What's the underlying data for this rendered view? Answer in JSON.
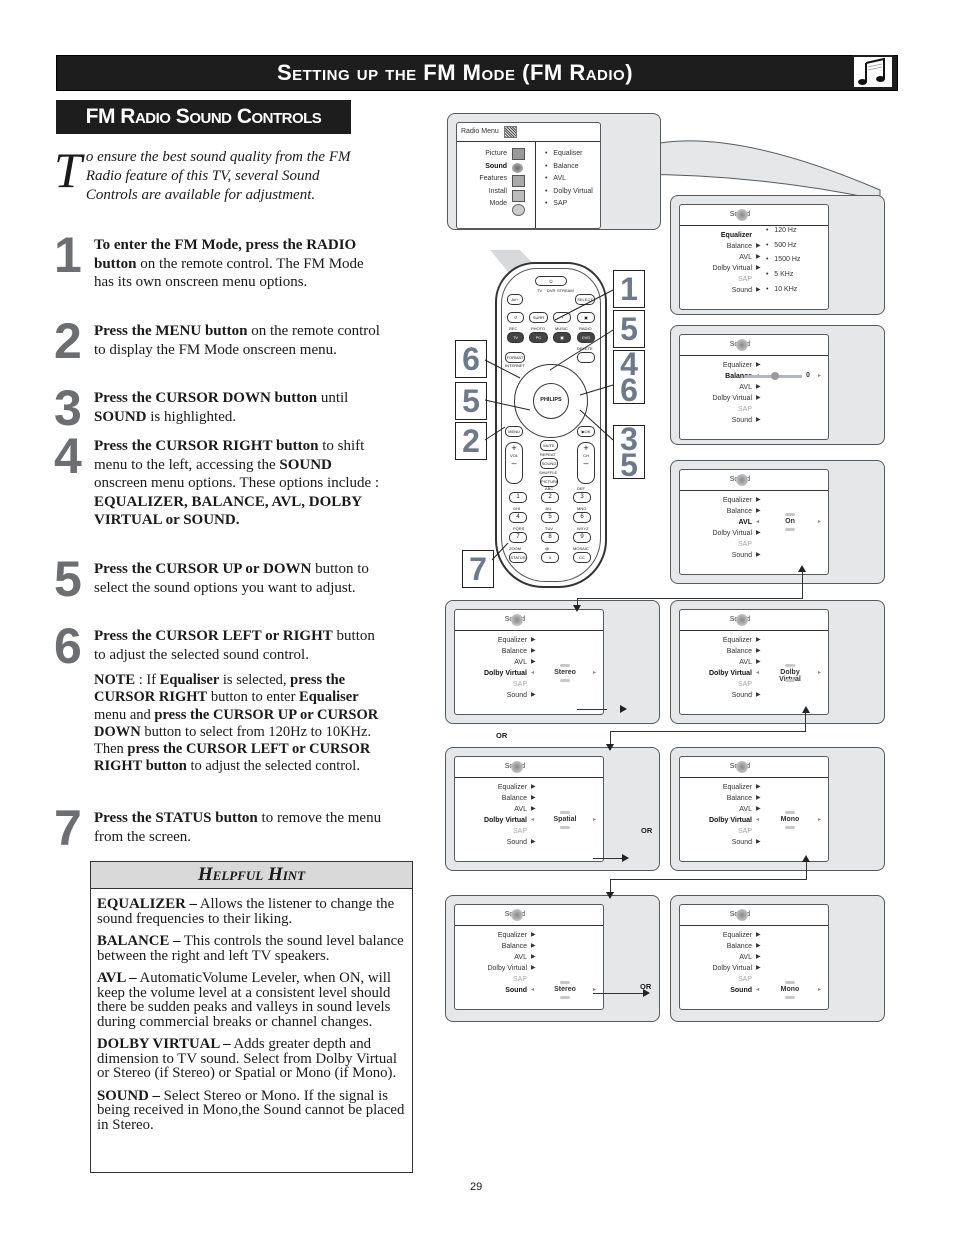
{
  "header": {
    "title": "Setting up the FM Mode (FM Radio)",
    "icon": "music-note-icon"
  },
  "section": {
    "title": "FM Radio Sound Controls"
  },
  "intro": {
    "dropcap": "T",
    "text": "o ensure the best sound quality from the FM Radio feature of this TV, several Sound Controls are available for adjustment."
  },
  "steps": [
    {
      "num": "1",
      "bold": "To enter the FM Mode, press the RADIO button",
      "text": " on the remote control. The FM Mode has its own onscreen menu options."
    },
    {
      "num": "2",
      "bold": "Press the MENU button",
      "text": " on the remote control to display the FM Mode onscreen menu."
    },
    {
      "num": "3",
      "bold": "Press the CURSOR DOWN button",
      "text": " until ",
      "bold2": "SOUND",
      "text2": " is highlighted."
    },
    {
      "num": "4",
      "bold": "Press the CURSOR RIGHT button",
      "text": " to shift menu to the left, accessing the ",
      "bold2": "SOUND",
      "text2": " onscreen menu options. These options include : ",
      "bold3": "EQUALIZER, BALANCE, AVL, DOLBY VIRTUAL or SOUND."
    },
    {
      "num": "5",
      "bold": "Press the CURSOR UP or DOWN",
      "text": " button to select the sound options you want to adjust."
    },
    {
      "num": "6",
      "bold": "Press the CURSOR LEFT or RIGHT",
      "text": " button to adjust the selected sound control."
    },
    {
      "num": "7",
      "bold": "Press the STATUS button",
      "text": " to remove the menu from the screen."
    }
  ],
  "note": {
    "p1": "NOTE",
    "p2": " : If ",
    "p3": "Equaliser",
    "p4": " is selected, ",
    "p5": "press the CURSOR RIGHT",
    "p6": " button to enter ",
    "p7": "Equaliser",
    "p8": " menu and ",
    "p9": "press the CURSOR UP or CURSOR DOWN",
    "p10": "  button to select from 120Hz to 10KHz. Then ",
    "p11": "press the CURSOR LEFT or CURSOR RIGHT button",
    "p12": " to adjust the selected control."
  },
  "hint": {
    "title": "Helpful Hint",
    "items": [
      {
        "term": "EQUALIZER  –",
        "desc": "  Allows the listener to change the sound frequencies to their liking."
      },
      {
        "term": "BALANCE  –",
        "desc": "  This controls the sound level balance between the right and left TV speakers."
      },
      {
        "term": "AVL –",
        "desc": "  AutomaticVolume Leveler, when ON, will keep the volume level at a consistent level should there be sudden peaks and valleys in sound levels during commercial breaks or channel changes."
      },
      {
        "term": "DOLBY VIRTUAL –",
        "desc": "  Adds greater depth and dimension to TV sound. Select from Dolby Virtual or Stereo (if Stereo) or Spatial or Mono (if Mono)."
      },
      {
        "term": "SOUND  –",
        "desc": "  Select Stereo or Mono. If the signal is being received in Mono,the Sound cannot be placed in Stereo."
      }
    ]
  },
  "radio_menu": {
    "title": "Radio Menu",
    "left": [
      {
        "label": "Picture",
        "icon": "picture-icon"
      },
      {
        "label": "Sound",
        "icon": "sound-icon",
        "selected": true
      },
      {
        "label": "Features",
        "icon": "features-icon"
      },
      {
        "label": "Install",
        "icon": "install-icon"
      },
      {
        "label": "Mode",
        "icon": "mode-icon"
      }
    ],
    "right": [
      "Equaliser",
      "Balance",
      "AVL",
      "Dolby Virtual",
      "SAP"
    ]
  },
  "sound_menu": {
    "title": "Sound",
    "items": [
      "Equalizer",
      "Balance",
      "AVL",
      "Dolby Virtual",
      "SAP",
      "Sound"
    ],
    "eq_bands": [
      "120 Hz",
      "500 Hz",
      "1500 Hz",
      "5 KHz",
      "10 KHz"
    ],
    "balance_value": "0",
    "avl_value": "On",
    "dolby_values": [
      "Stereo",
      "Dolby Virtual",
      "Spatial",
      "Mono"
    ],
    "sound_values": [
      "Stereo",
      "Mono"
    ]
  },
  "or_label": "OR",
  "remote": {
    "brand": "PHILIPS",
    "callouts": [
      "1",
      "5",
      "6",
      "5",
      "4",
      "6",
      "2",
      "3",
      "5",
      "7"
    ],
    "buttons": {
      "power": "⏻",
      "av": "AV+",
      "select": "SELECT",
      "tv": "TV",
      "dvr": "DVR",
      "stream": "STREAM",
      "r1": [
        "⏯",
        "■",
        "⏮",
        "⏭"
      ],
      "r1b": [
        "↺",
        "SURR",
        "◔",
        "▣"
      ],
      "r2lbl": [
        "REC",
        "PHOTO",
        "MUSIC",
        "RADIO"
      ],
      "r2": [
        "TV",
        "PC",
        "▣",
        "DVD"
      ],
      "format": "FORMAT",
      "internet": "INTERNET",
      "delete": "DELETE",
      "menu": "MENU",
      "ok": "▶OK",
      "mute": "MUTE",
      "repeat": "REPEAT",
      "sound": "SOUND",
      "shuffle": "SHUFFLE",
      "picture": "PICTURE",
      "vol": "VOL",
      "ch": "CH",
      "nums": [
        "1",
        "2",
        "3",
        "4",
        "5",
        "6",
        "7",
        "8",
        "9",
        "0"
      ],
      "numlbl": [
        ".",
        "ABC",
        "DEF",
        "GHI",
        "JKL",
        "MNO",
        "PQRS",
        "TUV",
        "WXYZ",
        "@"
      ],
      "zoom": "ZOOM",
      "status": "STATUS",
      "mosaic": "MOSAIC",
      "cc": "CC"
    }
  },
  "page_number": "29"
}
